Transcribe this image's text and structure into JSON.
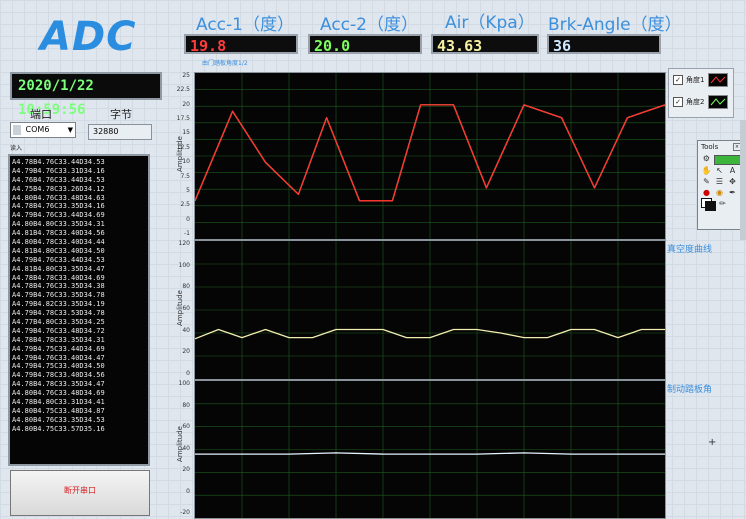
{
  "app": {
    "title": "ADC",
    "clock": "2020/1/22 10:59:56"
  },
  "indicators": [
    {
      "label": "Acc-1（度）",
      "value": "19.8",
      "color": "#ff3b3b"
    },
    {
      "label": "Acc-2（度）",
      "value": "20.0",
      "color": "#7cff5c"
    },
    {
      "label": "Air（Kpa）",
      "value": "43.63",
      "color": "#f5f0a0"
    },
    {
      "label": "Brk-Angle（度）",
      "value": "36",
      "color": "#cfe8ff"
    }
  ],
  "port": {
    "label": "端口",
    "value": "COM6"
  },
  "bytes": {
    "label": "字节",
    "value": "32880"
  },
  "read": {
    "label": "读入"
  },
  "readings": [
    "A4.78B4.76C33.44D34.53",
    "A4.79B4.76C33.31D34.16",
    "A4.76B4.76C33.44D34.53",
    "A4.75B4.78C33.26D34.12",
    "A4.80B4.76C33.48D34.63",
    "A4.78B4.76C33.35D34.16",
    "A4.79B4.76C33.44D34.69",
    "A4.80B4.80C33.35D34.31",
    "A4.81B4.78C33.40D34.56",
    "A4.80B4.78C33.40D34.44",
    "A4.81B4.80C33.40D34.50",
    "A4.79B4.76C33.44D34.53",
    "A4.81B4.80C33.35D34.47",
    "A4.78B4.78C33.40D34.69",
    "A4.78B4.76C33.35D34.38",
    "A4.79B4.76C33.35D34.78",
    "A4.79B4.82C33.35D34.19",
    "A4.79B4.78C33.53D34.78",
    "A4.77B4.80C33.35D34.25",
    "A4.79B4.76C33.48D34.72",
    "A4.78B4.78C33.35D34.31",
    "A4.79B4.75C33.44D34.69",
    "A4.79B4.76C33.40D34.47",
    "A4.79B4.75C33.40D34.50",
    "A4.79B4.78C33.40D34.56",
    "A4.78B4.78C33.35D34.47",
    "A4.80B4.76C33.48D34.69",
    "A4.78B4.80C33.31D34.41",
    "A4.80B4.75C33.48D34.87",
    "A4.80B4.76C33.35D34.53",
    "A4.80B4.75C33.57D35.16"
  ],
  "open_button": {
    "label": "断开串口"
  },
  "chart1": {
    "caption": "由门踏板角度1/2",
    "ylabel": "Amplitude",
    "ticks": [
      "25",
      "22.5",
      "20",
      "17.5",
      "15",
      "12.5",
      "10",
      "7.5",
      "5",
      "2.5",
      "0",
      "-1"
    ],
    "legend": [
      {
        "label": "角度1",
        "color": "#ff3030"
      },
      {
        "label": "角度2",
        "color": "#7cff5c"
      }
    ],
    "colors": {
      "series1": "#e8e070",
      "series2": "#ff3030"
    }
  },
  "chart2": {
    "caption": "真空度曲线",
    "ylabel": "Amplitude",
    "ticks": [
      "120",
      "100",
      "80",
      "60",
      "40",
      "20",
      "0"
    ],
    "color": "#f2eeb0"
  },
  "chart3": {
    "caption": "制动踏板角",
    "ylabel": "Amplitude",
    "ticks": [
      "100",
      "80",
      "60",
      "40",
      "20",
      "0",
      "-20"
    ],
    "color": "#e8f4ff"
  },
  "tools": {
    "label": "Tools"
  },
  "chart_data": [
    {
      "type": "line",
      "ylim": [
        -1,
        25
      ],
      "series": [
        {
          "name": "角度1",
          "x": [
            0,
            8,
            15,
            22,
            28,
            35,
            42,
            48,
            55,
            62,
            70,
            78,
            85,
            92,
            100
          ],
          "values": [
            5,
            19,
            11,
            6,
            18,
            5,
            5,
            20,
            20,
            7,
            20,
            18,
            7,
            18,
            20
          ]
        },
        {
          "name": "角度2",
          "x": [
            0,
            8,
            15,
            22,
            28,
            35,
            42,
            48,
            55,
            62,
            70,
            78,
            85,
            92,
            100
          ],
          "values": [
            5,
            19,
            11,
            6,
            18,
            5,
            5,
            20,
            20,
            7,
            20,
            18,
            7,
            18,
            20
          ]
        }
      ]
    },
    {
      "type": "line",
      "ylim": [
        0,
        120
      ],
      "series": [
        {
          "x": [
            0,
            5,
            10,
            15,
            20,
            25,
            30,
            35,
            40,
            45,
            50,
            55,
            60,
            65,
            70,
            75,
            80,
            85,
            90,
            95,
            100
          ],
          "values": [
            35,
            43,
            36,
            43,
            36,
            36,
            43,
            43,
            43,
            36,
            36,
            43,
            43,
            40,
            36,
            36,
            43,
            43,
            36,
            43,
            43
          ]
        }
      ]
    },
    {
      "type": "line",
      "ylim": [
        -20,
        100
      ],
      "series": [
        {
          "x": [
            0,
            10,
            20,
            30,
            40,
            50,
            60,
            70,
            80,
            90,
            100
          ],
          "values": [
            36,
            36,
            36,
            37,
            36,
            36,
            36,
            37,
            36,
            36,
            36
          ]
        }
      ]
    }
  ]
}
